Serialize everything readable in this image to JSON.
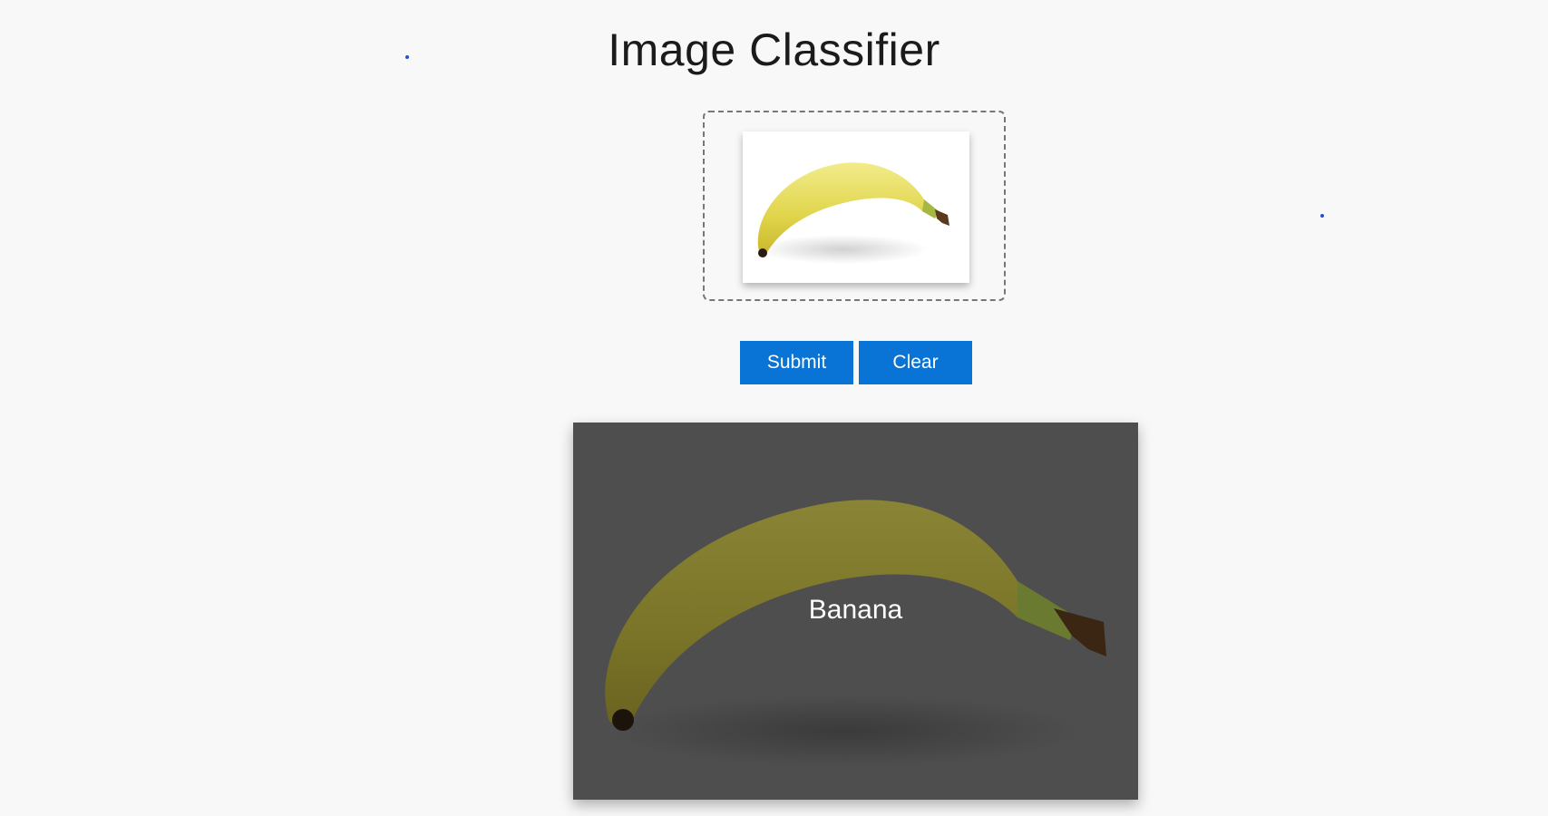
{
  "app": {
    "title": "Image Classifier"
  },
  "upload": {
    "image_alt": "banana-photo"
  },
  "actions": {
    "submit_label": "Submit",
    "clear_label": "Clear"
  },
  "result": {
    "label": "Banana"
  },
  "colors": {
    "button_bg": "#0a74d6",
    "result_overlay": "#4e4e4e",
    "background": "#f8f8f8"
  }
}
